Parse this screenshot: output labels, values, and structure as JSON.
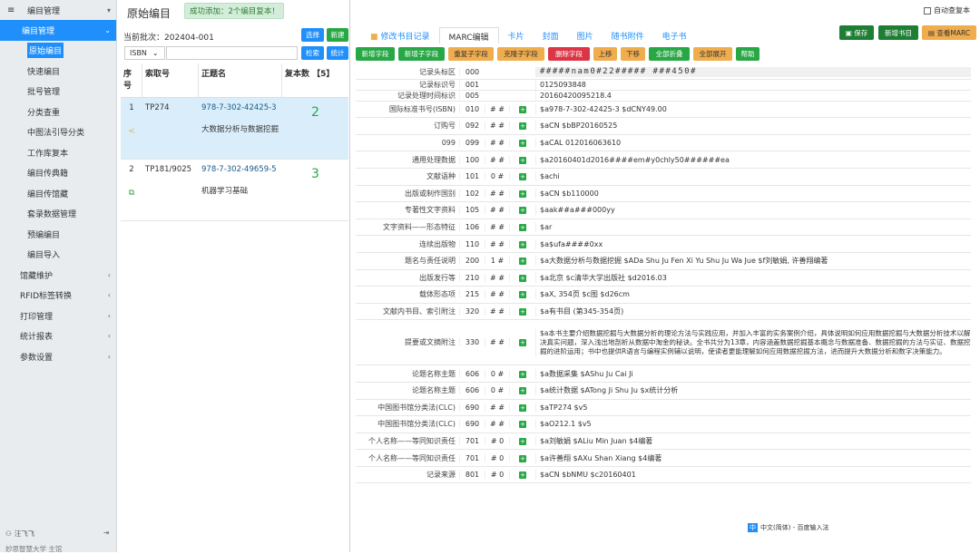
{
  "sidebar": {
    "top_label": "编目管理",
    "active_group": "编目管理",
    "sub_items": [
      "原始编目",
      "快速编目",
      "批号管理",
      "分类查重",
      "中图法引导分类",
      "工作库复本",
      "编目传典籍",
      "编目传馆藏",
      "套录数据管理",
      "预编编目",
      "编目导入"
    ],
    "groups": [
      "馆藏维护",
      "RFID标签转换",
      "打印管理",
      "统计报表",
      "参数设置"
    ],
    "footer_user": "汪飞飞",
    "footer_school": "妙思智慧大学 主馆"
  },
  "middle": {
    "title": "原始编目",
    "toast": "成功添加：2个编目复本！",
    "batch_label": "当前批次：",
    "batch_value": "202404-001",
    "btn_select": "选择",
    "btn_new": "新建",
    "isbn_option": "ISBN",
    "btn_search": "检索",
    "btn_stats": "统计",
    "head_no": "序号",
    "head_callno": "索取号",
    "head_title": "正题名",
    "head_copies": "复本数 【5】",
    "rows": [
      {
        "no": "1",
        "callno": "TP274",
        "isbn": "978-7-302-42425-3",
        "title": "大数据分析与数据挖掘",
        "copies": "2"
      },
      {
        "no": "2",
        "callno": "TP181/9025",
        "isbn": "978-7-302-49659-5",
        "title": "机器学习基础",
        "copies": "3"
      }
    ]
  },
  "right": {
    "tabs": [
      "修改书目记录",
      "MARC编辑",
      "卡片",
      "封面",
      "图片",
      "随书附件",
      "电子书"
    ],
    "top_buttons": [
      "保存",
      "新增书目",
      "查看MARC"
    ],
    "autocheck_label": "自动查复本",
    "tool_buttons": [
      "新增字段",
      "新增子字段",
      "重复子字段",
      "克隆子字段",
      "删除字段",
      "上移",
      "下移",
      "全部折叠",
      "全部展开",
      "帮助"
    ],
    "marc_rows": [
      {
        "name": "记录头标区",
        "tag": "000",
        "i1": "",
        "i2": "",
        "val": "#####nam0#22#####  ###450#"
      },
      {
        "name": "记录标识号",
        "tag": "001",
        "i1": "",
        "i2": "",
        "val": "0125093848"
      },
      {
        "name": "记录处理时间标识",
        "tag": "005",
        "i1": "",
        "i2": "",
        "val": "20160420095218.4"
      },
      {
        "name": "国际标准书号(ISBN)",
        "tag": "010",
        "i1": "#",
        "i2": "#",
        "val": "$a978-7-302-42425-3 $dCNY49.00"
      },
      {
        "name": "订购号",
        "tag": "092",
        "i1": "#",
        "i2": "#",
        "val": "$aCN $bBP20160525"
      },
      {
        "name": "099",
        "tag": "099",
        "i1": "#",
        "i2": "#",
        "val": "$aCAL 012016063610"
      },
      {
        "name": "通用处理数据",
        "tag": "100",
        "i1": "#",
        "i2": "#",
        "val": "$a20160401d2016####em#y0chly50######ea"
      },
      {
        "name": "文献语种",
        "tag": "101",
        "i1": "0",
        "i2": "#",
        "val": "$achi"
      },
      {
        "name": "出版或制作国别",
        "tag": "102",
        "i1": "#",
        "i2": "#",
        "val": "$aCN $b110000"
      },
      {
        "name": "专著性文字资料",
        "tag": "105",
        "i1": "#",
        "i2": "#",
        "val": "$aak##a###000yy"
      },
      {
        "name": "文字资料——形态特征",
        "tag": "106",
        "i1": "#",
        "i2": "#",
        "val": "$ar"
      },
      {
        "name": "连续出版物",
        "tag": "110",
        "i1": "#",
        "i2": "#",
        "val": "$a$ufa####0xx"
      },
      {
        "name": "题名与责任说明",
        "tag": "200",
        "i1": "1",
        "i2": "#",
        "val": "$a大数据分析与数据挖掘 $ADa Shu Ju Fen Xi Yu Shu Ju Wa Jue $f刘敏娟, 许善翔编著"
      },
      {
        "name": "出版发行等",
        "tag": "210",
        "i1": "#",
        "i2": "#",
        "val": "$a北京 $c清华大学出版社 $d2016.03"
      },
      {
        "name": "载体形态项",
        "tag": "215",
        "i1": "#",
        "i2": "#",
        "val": "$aX, 354页 $c图 $d26cm"
      },
      {
        "name": "文献内书目、索引附注",
        "tag": "320",
        "i1": "#",
        "i2": "#",
        "val": "$a有书目 (第345-354页)"
      },
      {
        "name": "提要或文摘附注",
        "tag": "330",
        "i1": "#",
        "i2": "#",
        "val": "$a本书主要介绍数据挖掘与大数据分析的理论方法与实践应用，并加入丰富的实务案例介绍，具体说明如何应用数据挖掘与大数据分析技术以解决真实问题，深入浅出地剖析从数据中淘金的秘诀。全书共分为13章，内容涵盖数据挖掘基本概念与数据准备、数据挖掘的方法与实证、数据挖掘的进阶运用；书中也提供R语言与编程实例辅以说明，使读者更能理解如何应用数据挖掘方法，进而提升大数据分析和数字决策能力。"
      },
      {
        "name": "论题名称主题",
        "tag": "606",
        "i1": "0",
        "i2": "#",
        "val": "$a数据采集 $AShu Ju Cai Ji"
      },
      {
        "name": "论题名称主题",
        "tag": "606",
        "i1": "0",
        "i2": "#",
        "val": "$a统计数据 $ATong Ji Shu Ju $x统计分析"
      },
      {
        "name": "中国图书馆分类法(CLC)",
        "tag": "690",
        "i1": "#",
        "i2": "#",
        "val": "$aTP274 $v5"
      },
      {
        "name": "中国图书馆分类法(CLC)",
        "tag": "690",
        "i1": "#",
        "i2": "#",
        "val": "$aO212.1 $v5"
      },
      {
        "name": "个人名称——等同知识责任",
        "tag": "701",
        "i1": "#",
        "i2": "0",
        "val": "$a刘敏娟 $ALiu Min Juan $4编著"
      },
      {
        "name": "个人名称——等同知识责任",
        "tag": "701",
        "i1": "#",
        "i2": "0",
        "val": "$a许善翔 $AXu Shan Xiang $4编著"
      },
      {
        "name": "记录来源",
        "tag": "801",
        "i1": "#",
        "i2": "0",
        "val": "$aCN $bNMU $c20160401"
      }
    ],
    "ime_badge": "中",
    "ime_text": "中文(简体) - 百度输入法"
  }
}
